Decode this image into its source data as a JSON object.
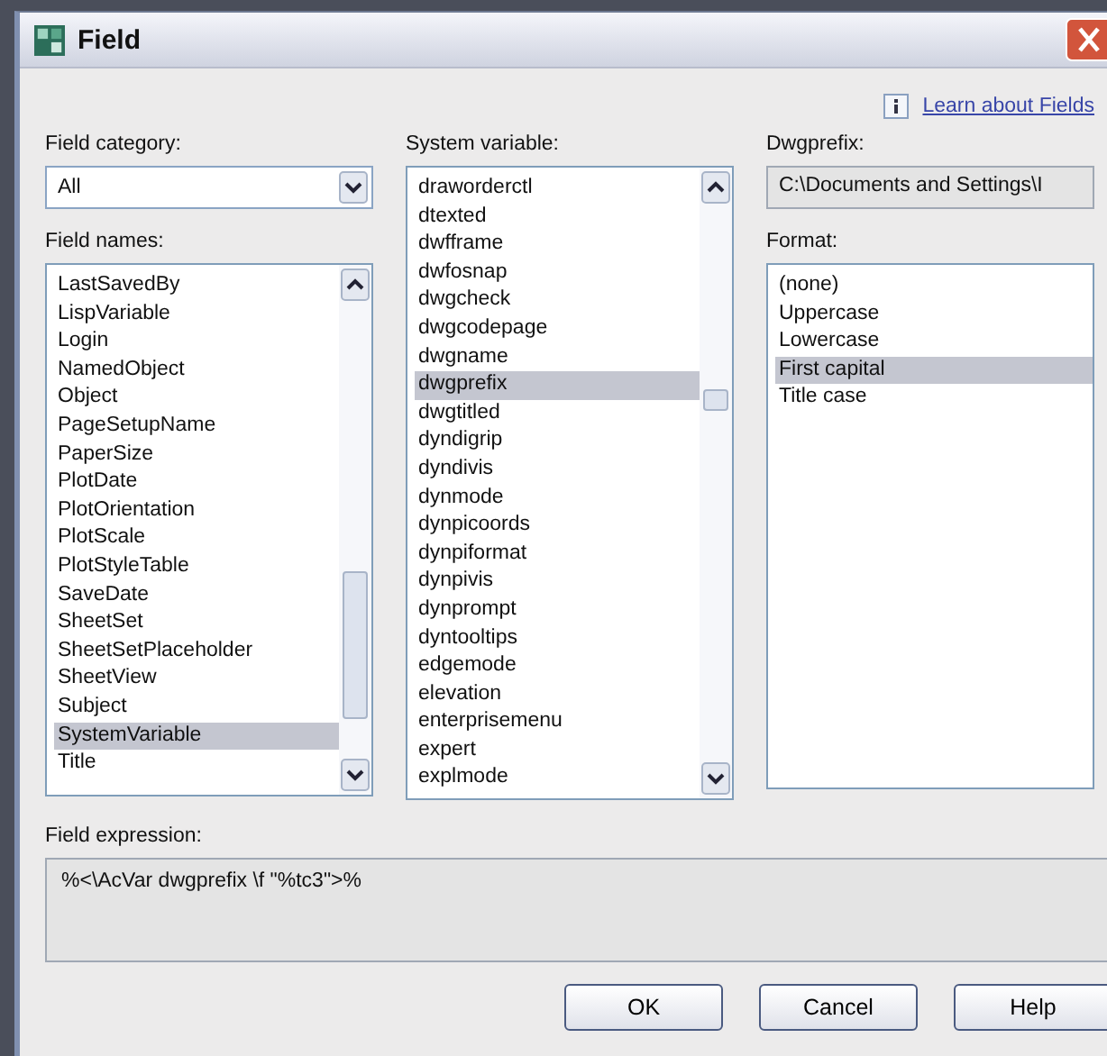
{
  "window": {
    "title": "Field"
  },
  "help_link": "Learn about Fields",
  "field_category": {
    "label": "Field category:",
    "value": "All"
  },
  "field_names": {
    "label": "Field names:",
    "items": [
      {
        "text": "LastSavedBy",
        "selected": false
      },
      {
        "text": "LispVariable",
        "selected": false
      },
      {
        "text": "Login",
        "selected": false
      },
      {
        "text": "NamedObject",
        "selected": false
      },
      {
        "text": "Object",
        "selected": false
      },
      {
        "text": "PageSetupName",
        "selected": false
      },
      {
        "text": "PaperSize",
        "selected": false
      },
      {
        "text": "PlotDate",
        "selected": false
      },
      {
        "text": "PlotOrientation",
        "selected": false
      },
      {
        "text": "PlotScale",
        "selected": false
      },
      {
        "text": "PlotStyleTable",
        "selected": false
      },
      {
        "text": "SaveDate",
        "selected": false
      },
      {
        "text": "SheetSet",
        "selected": false
      },
      {
        "text": "SheetSetPlaceholder",
        "selected": false
      },
      {
        "text": "SheetView",
        "selected": false
      },
      {
        "text": "Subject",
        "selected": false
      },
      {
        "text": "SystemVariable",
        "selected": true
      },
      {
        "text": "Title",
        "selected": false
      }
    ]
  },
  "system_variable": {
    "label": "System variable:",
    "items": [
      {
        "text": "draworderctl",
        "selected": false
      },
      {
        "text": "dtexted",
        "selected": false
      },
      {
        "text": "dwfframe",
        "selected": false
      },
      {
        "text": "dwfosnap",
        "selected": false
      },
      {
        "text": "dwgcheck",
        "selected": false
      },
      {
        "text": "dwgcodepage",
        "selected": false
      },
      {
        "text": "dwgname",
        "selected": false
      },
      {
        "text": "dwgprefix",
        "selected": true
      },
      {
        "text": "dwgtitled",
        "selected": false
      },
      {
        "text": "dyndigrip",
        "selected": false
      },
      {
        "text": "dyndivis",
        "selected": false
      },
      {
        "text": "dynmode",
        "selected": false
      },
      {
        "text": "dynpicoords",
        "selected": false
      },
      {
        "text": "dynpiformat",
        "selected": false
      },
      {
        "text": "dynpivis",
        "selected": false
      },
      {
        "text": "dynprompt",
        "selected": false
      },
      {
        "text": "dyntooltips",
        "selected": false
      },
      {
        "text": "edgemode",
        "selected": false
      },
      {
        "text": "elevation",
        "selected": false
      },
      {
        "text": "enterprisemenu",
        "selected": false
      },
      {
        "text": "expert",
        "selected": false
      },
      {
        "text": "explmode",
        "selected": false
      }
    ]
  },
  "preview": {
    "label": "Dwgprefix:",
    "value": "C:\\Documents and Settings\\I"
  },
  "format": {
    "label": "Format:",
    "items": [
      {
        "text": "(none)",
        "selected": false
      },
      {
        "text": "Uppercase",
        "selected": false
      },
      {
        "text": "Lowercase",
        "selected": false
      },
      {
        "text": "First capital",
        "selected": true
      },
      {
        "text": "Title case",
        "selected": false
      }
    ]
  },
  "field_expression": {
    "label": "Field expression:",
    "value": "%<\\AcVar dwgprefix \\f \"%tc3\">%"
  },
  "buttons": [
    "OK",
    "Cancel",
    "Help"
  ]
}
